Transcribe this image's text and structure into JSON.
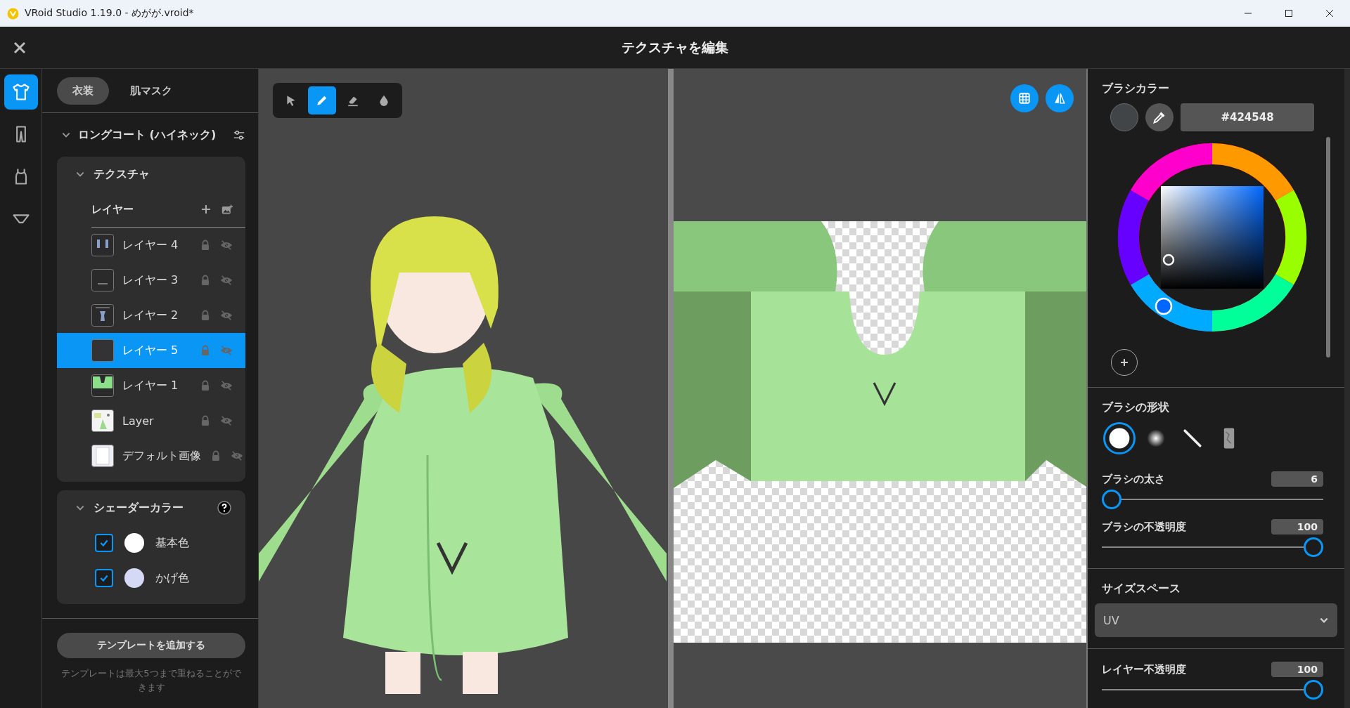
{
  "window": {
    "title": "VRoid Studio 1.19.0 - めがが.vroid*"
  },
  "header": {
    "title": "テクスチャを編集"
  },
  "rail": [
    {
      "kind": "shirt",
      "selected": true
    },
    {
      "kind": "pants",
      "selected": false
    },
    {
      "kind": "tank",
      "selected": false
    },
    {
      "kind": "underwear",
      "selected": false
    }
  ],
  "tabs": [
    {
      "label": "衣装",
      "selected": true
    },
    {
      "label": "肌マスク",
      "selected": false
    }
  ],
  "item": {
    "title": "ロングコート (ハイネック)"
  },
  "texture": {
    "title": "テクスチャ",
    "layers_label": "レイヤー",
    "layers": [
      {
        "name": "レイヤー 4",
        "kind": "sleeves",
        "selected": false
      },
      {
        "name": "レイヤー 3",
        "kind": "line",
        "selected": false
      },
      {
        "name": "レイヤー 2",
        "kind": "figure",
        "selected": false
      },
      {
        "name": "レイヤー 5",
        "kind": "dark",
        "selected": true
      },
      {
        "name": "レイヤー 1",
        "kind": "green",
        "selected": false
      },
      {
        "name": "Layer",
        "kind": "texture",
        "selected": false
      },
      {
        "name": "デフォルト画像",
        "kind": "white",
        "selected": false
      }
    ]
  },
  "shader": {
    "title": "シェーダーカラー",
    "items": [
      {
        "label": "基本色",
        "checked": true,
        "color": "#ffffff"
      },
      {
        "label": "かげ色",
        "checked": true,
        "color": "#d5d9f5"
      }
    ]
  },
  "template": {
    "button": "テンプレートを追加する",
    "note": "テンプレートは最大5つまで重ねることができます"
  },
  "tools": [
    {
      "kind": "select",
      "selected": false
    },
    {
      "kind": "pen",
      "selected": true
    },
    {
      "kind": "eraser",
      "selected": false
    },
    {
      "kind": "fill",
      "selected": false
    }
  ],
  "brush_color": {
    "title": "ブラシカラー",
    "hex": "#424548"
  },
  "brush_shape": {
    "title": "ブラシの形状",
    "shapes": [
      {
        "kind": "hard",
        "selected": true
      },
      {
        "kind": "soft",
        "selected": false
      },
      {
        "kind": "line",
        "selected": false
      },
      {
        "kind": "texture",
        "selected": false
      }
    ]
  },
  "brush_size": {
    "label": "ブラシの太さ",
    "value": "6",
    "level": 0.0
  },
  "brush_opacity": {
    "label": "ブラシの不透明度",
    "value": "100",
    "level": 1.0
  },
  "size_space": {
    "title": "サイズスペース",
    "value": "UV"
  },
  "layer_opacity": {
    "label": "レイヤー不透明度",
    "value": "100",
    "level": 1.0
  }
}
